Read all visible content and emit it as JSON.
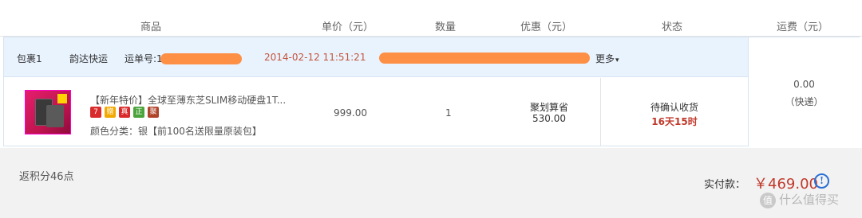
{
  "columns": {
    "product": "商品",
    "unit_price": "单价（元）",
    "quantity": "数量",
    "discount": "优惠（元）",
    "status": "状态",
    "shipping": "运费（元）"
  },
  "package": {
    "name": "包裹1",
    "carrier": "韵达快运",
    "tracking_label": "运单号:1",
    "date": "2014-02-12 11:51:21",
    "more": "更多"
  },
  "item": {
    "title": "【新年特价】全球至薄东芝SLIM移动硬盘1T...",
    "badges": [
      "7",
      "赠",
      "真",
      "正",
      "聚"
    ],
    "variant": "颜色分类：银【前100名送限量原装包】",
    "price": "999.00",
    "quantity": "1",
    "discount_label": "聚划算省",
    "discount_amount": "530.00",
    "status": "待确认收货",
    "status_time": "16天15时"
  },
  "shipping": {
    "price": "0.00",
    "method": "（快递）"
  },
  "footer": {
    "points": "返积分46点",
    "paid_label": "实付款：",
    "paid_amount": "￥469.00",
    "info_glyph": "!",
    "watermark": "什么值得买",
    "watermark_logo": "值"
  },
  "colors": {
    "accent_red": "#c0392b",
    "package_bar_bg": "#e9f3fe",
    "redaction": "#ff8a3c",
    "info_blue": "#2a6fd6"
  }
}
